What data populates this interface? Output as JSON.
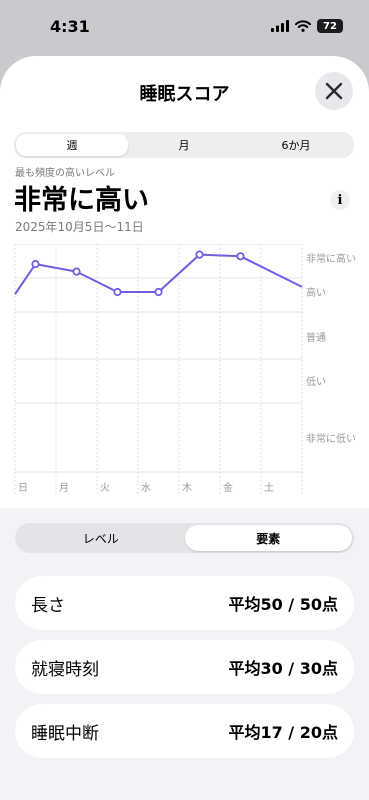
{
  "status_bar": {
    "time": "4:31",
    "battery": "72"
  },
  "header": {
    "title": "睡眠スコア"
  },
  "period_tabs": [
    {
      "label": "週",
      "active": true
    },
    {
      "label": "月",
      "active": false
    },
    {
      "label": "6か月",
      "active": false
    }
  ],
  "summary": {
    "hint": "最も頻度の高いレベル",
    "level": "非常に高い",
    "date_range": "2025年10月5日〜11日",
    "info_icon": "i"
  },
  "chart_data": {
    "type": "line",
    "categories": [
      "日",
      "月",
      "火",
      "水",
      "木",
      "金",
      "土"
    ],
    "level_labels": [
      "非常に高い",
      "高い",
      "普通",
      "低い",
      "非常に低い"
    ],
    "series": [
      {
        "values": [
          4.82,
          4.6,
          4.0,
          4.0,
          5.1,
          5.05
        ]
      }
    ],
    "line_color": "#6e5fe0",
    "grid": true
  },
  "view_tabs": [
    {
      "label": "レベル",
      "active": false
    },
    {
      "label": "要素",
      "active": true
    }
  ],
  "factors": [
    {
      "name": "長さ",
      "value": "平均50 / 50点"
    },
    {
      "name": "就寝時刻",
      "value": "平均30 / 30点"
    },
    {
      "name": "睡眠中断",
      "value": "平均17 / 20点"
    }
  ]
}
